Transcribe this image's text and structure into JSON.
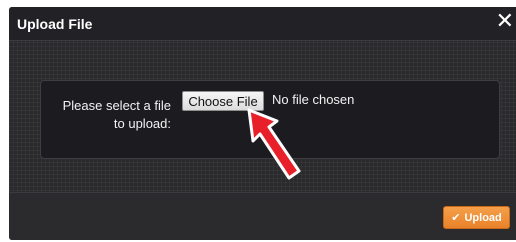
{
  "dialog": {
    "title": "Upload File",
    "close_icon": "✕"
  },
  "form": {
    "label_line1": "Please select a file",
    "label_line2": "to upload:",
    "choose_button": "Choose File",
    "file_status": "No file chosen"
  },
  "footer": {
    "upload_icon": "✔",
    "upload_label": "Upload"
  },
  "colors": {
    "accent": "#e9822a",
    "arrow": "#e8202a"
  }
}
